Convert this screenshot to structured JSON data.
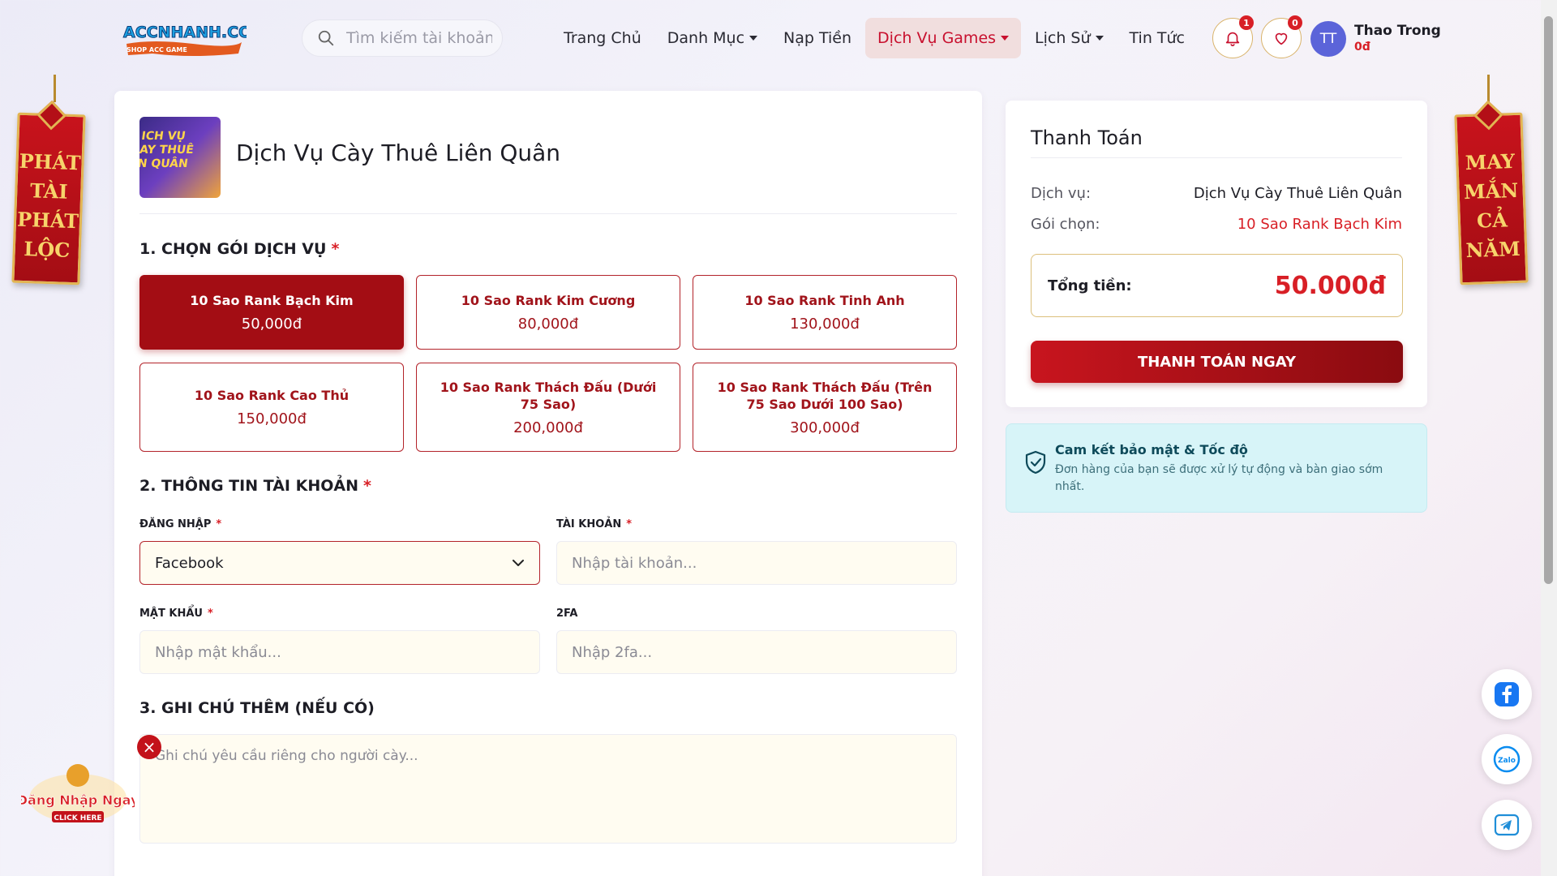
{
  "header": {
    "logo_text": "ACCNHANH.COM",
    "logo_sub": "SHOP ACC GAME",
    "search_placeholder": "Tìm kiếm tài khoản",
    "nav": [
      {
        "label": "Trang Chủ",
        "dropdown": false
      },
      {
        "label": "Danh Mục",
        "dropdown": true
      },
      {
        "label": "Nạp Tiền",
        "dropdown": false
      },
      {
        "label": "Dịch Vụ Games",
        "dropdown": true,
        "active": true
      },
      {
        "label": "Lịch Sử",
        "dropdown": true
      },
      {
        "label": "Tin Tức",
        "dropdown": false
      }
    ],
    "notification_count": "1",
    "wishlist_count": "0",
    "user": {
      "initials": "TT",
      "name": "Thao Trong",
      "balance": "0đ"
    }
  },
  "banners": {
    "left": [
      "PHÁT",
      "TÀI",
      "PHÁT",
      "LỘC"
    ],
    "right": [
      "MAY",
      "MẮN",
      "CẢ",
      "NĂM"
    ]
  },
  "service": {
    "thumb_text": [
      "ICH VỤ",
      "AY THUÊ",
      "N QUÂN"
    ],
    "title": "Dịch Vụ Cày Thuê Liên Quân",
    "section1": "1. CHỌN GÓI DỊCH VỤ",
    "packages": [
      {
        "name": "10 Sao Rank Bạch Kim",
        "price": "50,000đ",
        "selected": true
      },
      {
        "name": "10 Sao Rank Kim Cương",
        "price": "80,000đ"
      },
      {
        "name": "10 Sao Rank Tinh Anh",
        "price": "130,000đ"
      },
      {
        "name": "10 Sao Rank Cao Thủ",
        "price": "150,000đ"
      },
      {
        "name": "10 Sao Rank Thách Đấu (Dưới 75 Sao)",
        "price": "200,000đ"
      },
      {
        "name": "10 Sao Rank Thách Đấu (Trên 75 Sao Dưới 100 Sao)",
        "price": "300,000đ"
      }
    ],
    "section2": "2. THÔNG TIN TÀI KHOẢN",
    "login_label": "ĐĂNG NHẬP",
    "login_value": "Facebook",
    "account_label": "TÀI KHOẢN",
    "account_placeholder": "Nhập tài khoản...",
    "password_label": "MẬT KHẨU",
    "password_placeholder": "Nhập mật khẩu...",
    "twofa_label": "2FA",
    "twofa_placeholder": "Nhập 2fa...",
    "section3": "3. GHI CHÚ THÊM (NẾU CÓ)",
    "note_placeholder": "Ghi chú yêu cầu riêng cho người cày..."
  },
  "checkout": {
    "title": "Thanh Toán",
    "service_label": "Dịch vụ:",
    "service_value": "Dịch Vụ Cày Thuê Liên Quân",
    "package_label": "Gói chọn:",
    "package_value": "10 Sao Rank Bạch Kim",
    "total_label": "Tổng tiền:",
    "total_value": "50.000đ",
    "pay_button": "THANH TOÁN NGAY"
  },
  "security": {
    "title": "Cam kết bảo mật & Tốc độ",
    "text": "Đơn hàng của bạn sẽ được xử lý tự động và bàn giao sớm nhất."
  },
  "promo": {
    "line1": "Đăng Nhập Ngay",
    "line2": "CLICK HERE"
  },
  "contacts": {
    "zalo": "Zalo"
  },
  "colors": {
    "accent": "#a30d14",
    "price": "#d81f26",
    "gold": "#e2b552"
  }
}
